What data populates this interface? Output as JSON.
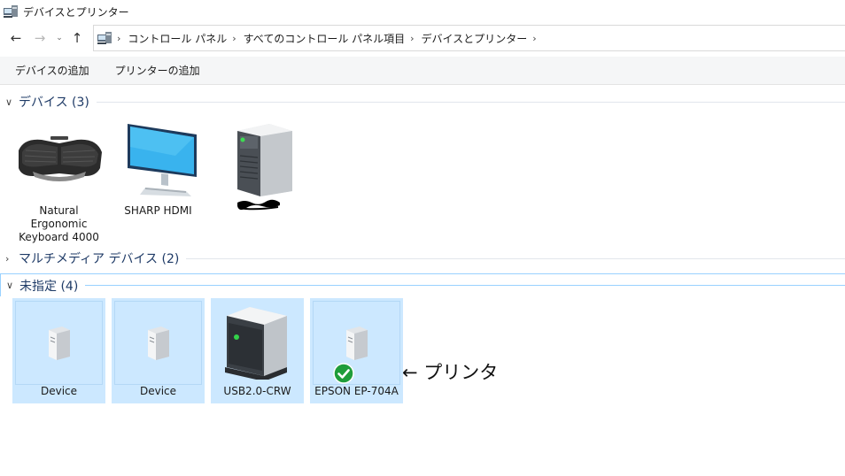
{
  "window": {
    "title": "デバイスとプリンター"
  },
  "nav": {
    "back": "←",
    "forward": "→",
    "recent": "⌄",
    "up": "↑"
  },
  "breadcrumb": {
    "items": [
      "コントロール パネル",
      "すべてのコントロール パネル項目",
      "デバイスとプリンター"
    ],
    "separator": "›"
  },
  "toolbar": {
    "add_device": "デバイスの追加",
    "add_printer": "プリンターの追加"
  },
  "groups": {
    "devices": {
      "label": "デバイス (3)",
      "items": [
        {
          "label": "Natural\nErgonomic\nKeyboard 4000"
        },
        {
          "label": "SHARP HDMI"
        }
      ]
    },
    "multimedia": {
      "label": "マルチメディア デバイス (2)"
    },
    "unspecified": {
      "label": "未指定 (4)",
      "items": [
        {
          "label": "Device"
        },
        {
          "label": "Device"
        },
        {
          "label": "USB2.0-CRW"
        },
        {
          "label": "EPSON EP-704A"
        }
      ]
    }
  },
  "annotation": "← プリンタ",
  "colors": {
    "selection": "#cce8ff",
    "selection_border": "#99d1ff",
    "group_header": "#1e3a66",
    "default_check": "#1f9d3a"
  }
}
